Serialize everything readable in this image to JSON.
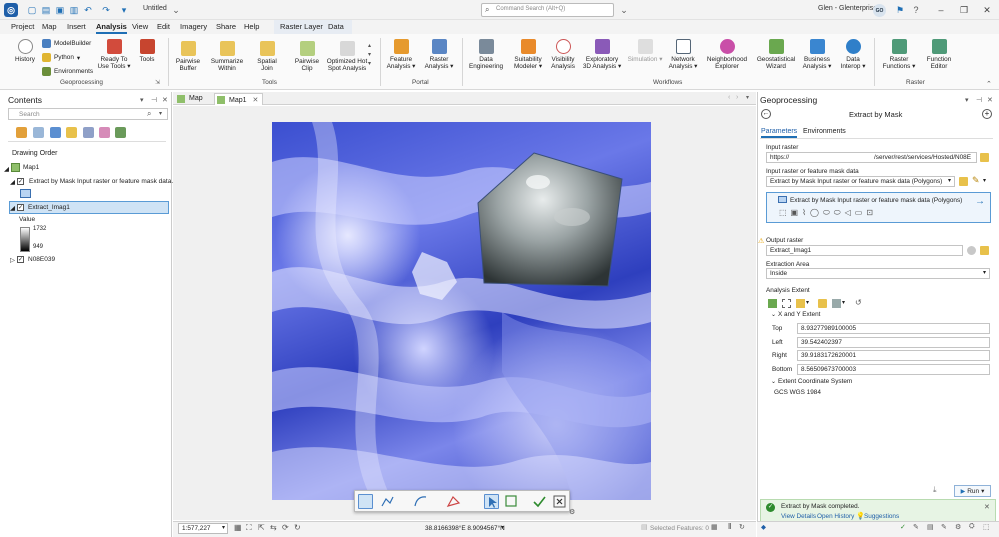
{
  "titlebar": {
    "doc_title": "Untitled",
    "search_placeholder": "Command Search (Alt+Q)",
    "user_name": "Glen - Glenterprise",
    "user_initials": "GO"
  },
  "menu": {
    "tabs": [
      "Project",
      "Map",
      "Insert",
      "Analysis",
      "View",
      "Edit",
      "Imagery",
      "Share",
      "Help",
      "Raster Layer",
      "Data"
    ],
    "active": "Analysis"
  },
  "ribbon": {
    "geoprocessing": {
      "label": "Geoprocessing",
      "history": "History",
      "modelbuilder": "ModelBuilder",
      "python": "Python",
      "environments": "Environments",
      "ready_to_use_1": "Ready To",
      "ready_to_use_2": "Use Tools",
      "tools": "Tools"
    },
    "tools_group": {
      "label": "Tools",
      "items": [
        {
          "l1": "Pairwise",
          "l2": "Buffer"
        },
        {
          "l1": "Summarize",
          "l2": "Within"
        },
        {
          "l1": "Spatial",
          "l2": "Join"
        },
        {
          "l1": "Pairwise",
          "l2": "Clip"
        },
        {
          "l1": "Optimized Hot",
          "l2": "Spot Analysis"
        }
      ]
    },
    "portal": {
      "label": "Portal",
      "items": [
        {
          "l1": "Feature",
          "l2": "Analysis"
        },
        {
          "l1": "Raster",
          "l2": "Analysis"
        }
      ]
    },
    "workflows": {
      "label": "Workflows",
      "items": [
        {
          "l1": "Data",
          "l2": "Engineering"
        },
        {
          "l1": "Suitability",
          "l2": "Modeler"
        },
        {
          "l1": "Visibility",
          "l2": "Analysis"
        },
        {
          "l1": "Exploratory",
          "l2": "3D Analysis"
        },
        {
          "l1": "Simulation",
          "l2": ""
        },
        {
          "l1": "Network",
          "l2": "Analysis"
        },
        {
          "l1": "Neighborhood",
          "l2": "Explorer"
        },
        {
          "l1": "Geostatistical",
          "l2": "Wizard"
        },
        {
          "l1": "Business",
          "l2": "Analysis"
        },
        {
          "l1": "Data",
          "l2": "Interop"
        }
      ]
    },
    "raster": {
      "label": "Raster",
      "items": [
        {
          "l1": "Raster",
          "l2": "Functions"
        },
        {
          "l1": "Function",
          "l2": "Editor"
        }
      ]
    }
  },
  "contents": {
    "title": "Contents",
    "search_placeholder": "Search",
    "drawing_order": "Drawing Order",
    "map_name": "Map1",
    "layers": [
      "Extract by Mask Input raster or feature mask data...",
      "Extract_Imag1",
      "N08E039"
    ],
    "legend_title": "Value",
    "legend_max": "1732",
    "legend_min": "949"
  },
  "map": {
    "tabs": [
      "Map",
      "Map1"
    ],
    "scale": "1:577,227",
    "coordinates": "38.8166398°E 8.9094567°N",
    "selected_features": "Selected Features: 0"
  },
  "gp": {
    "title": "Geoprocessing",
    "tool_name": "Extract by Mask",
    "tab_parameters": "Parameters",
    "tab_environments": "Environments",
    "input_raster_label": "Input raster",
    "input_raster_prefix": "https://",
    "input_raster_suffix": "/server/rest/services/Hosted/N08E",
    "mask_label": "Input raster or feature mask data",
    "mask_value": "Extract by Mask Input raster or feature mask data (Polygons)",
    "mask_box_text": "Extract by Mask Input raster or feature mask data (Polygons)",
    "output_label": "Output raster",
    "output_value": "Extract_Imag1",
    "extraction_area_label": "Extraction Area",
    "extraction_area_value": "Inside",
    "analysis_extent_label": "Analysis Extent",
    "xy_extent_label": "X and Y Extent",
    "extent": [
      {
        "label": "Top",
        "value": "8.93277989100005"
      },
      {
        "label": "Left",
        "value": "39.542402397"
      },
      {
        "label": "Right",
        "value": "39.9183172620001"
      },
      {
        "label": "Bottom",
        "value": "8.56509673700003"
      }
    ],
    "coord_system_label": "Extent Coordinate System",
    "coord_system_value": "GCS WGS 1984",
    "run_label": "Run",
    "banner_title": "Extract by Mask completed.",
    "banner_view_details": "View Details",
    "banner_open_history": "Open History",
    "banner_suggestions": "Suggestions"
  },
  "colors": {
    "accent": "#1f6fb5",
    "raster_blue": "#3b4fd0",
    "selection": "#cfe3f5"
  }
}
